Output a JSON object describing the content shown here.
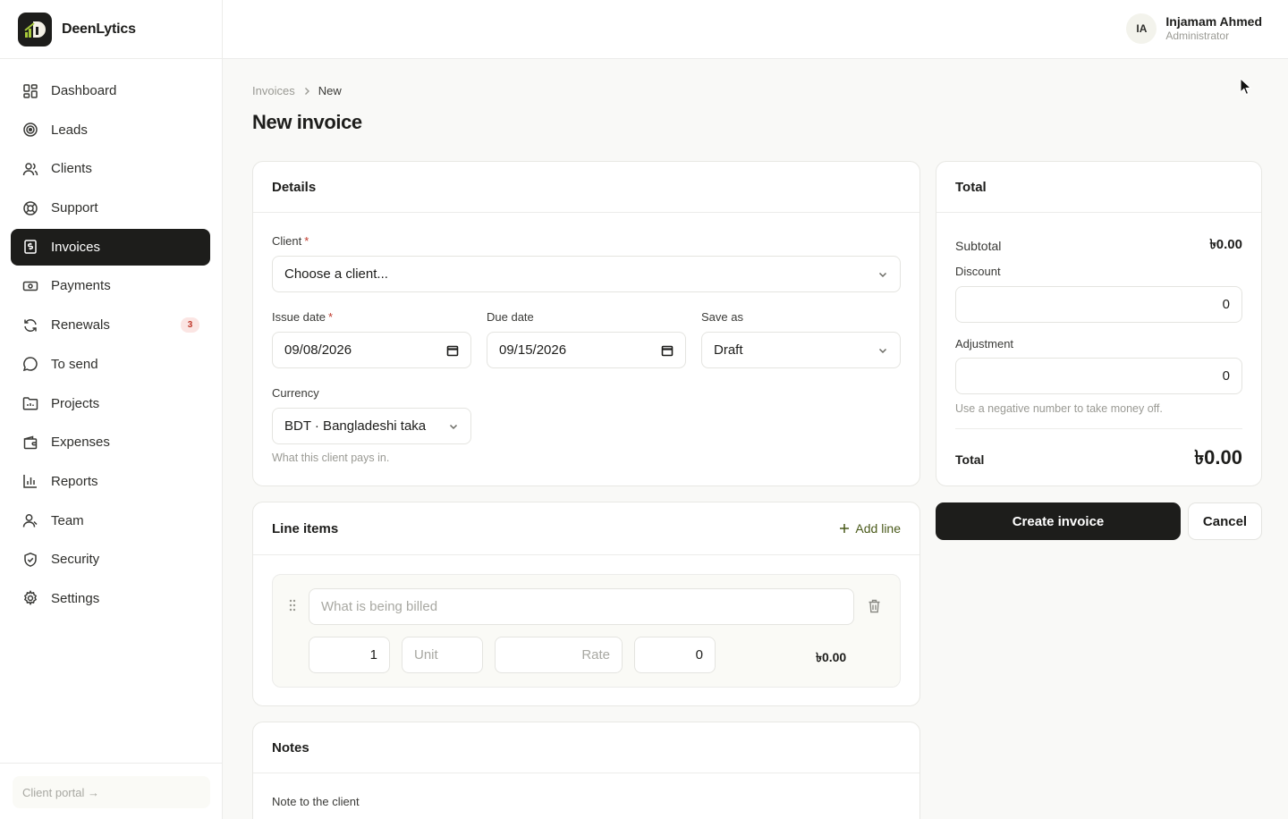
{
  "app": {
    "name": "DeenLytics"
  },
  "user": {
    "initials": "IA",
    "name": "Injamam Ahmed",
    "role": "Administrator"
  },
  "sidebar": {
    "items": [
      {
        "label": "Dashboard",
        "icon": "dashboard-icon"
      },
      {
        "label": "Leads",
        "icon": "target-icon"
      },
      {
        "label": "Clients",
        "icon": "users-icon"
      },
      {
        "label": "Support",
        "icon": "lifebuoy-icon"
      },
      {
        "label": "Invoices",
        "icon": "invoice-icon",
        "active": true
      },
      {
        "label": "Payments",
        "icon": "banknote-icon"
      },
      {
        "label": "Renewals",
        "icon": "refresh-icon",
        "badge": "3"
      },
      {
        "label": "To send",
        "icon": "chat-bubble-icon"
      },
      {
        "label": "Projects",
        "icon": "folder-icon"
      },
      {
        "label": "Expenses",
        "icon": "wallet-icon"
      },
      {
        "label": "Reports",
        "icon": "bar-chart-icon"
      },
      {
        "label": "Team",
        "icon": "team-icon"
      },
      {
        "label": "Security",
        "icon": "shield-icon"
      },
      {
        "label": "Settings",
        "icon": "gear-icon"
      }
    ],
    "footer_link": "Client portal →"
  },
  "breadcrumb": {
    "parent": "Invoices",
    "current": "New"
  },
  "page": {
    "title": "New invoice"
  },
  "details": {
    "title": "Details",
    "client_label": "Client",
    "required_mark": "*",
    "client_value": "Choose a client...",
    "issue_date_label": "Issue date",
    "issue_date_value": "09/08/2026",
    "due_date_label": "Due date",
    "due_date_value": "09/15/2026",
    "save_as_label": "Save as",
    "save_as_value": "Draft",
    "currency_label": "Currency",
    "currency_value": "BDT · Bangladeshi taka",
    "currency_hint": "What this client pays in."
  },
  "line_items": {
    "title": "Line items",
    "add_label": "Add line",
    "description_placeholder": "What is being billed",
    "quantity": "1",
    "unit_placeholder": "Unit",
    "rate_placeholder": "Rate",
    "tax": "0",
    "line_total": "৳0.00"
  },
  "notes": {
    "title": "Notes",
    "note_label": "Note to the client"
  },
  "totals": {
    "title": "Total",
    "subtotal_label": "Subtotal",
    "subtotal_value": "৳0.00",
    "discount_label": "Discount",
    "discount_value": "0",
    "adjustment_label": "Adjustment",
    "adjustment_value": "0",
    "adjustment_hint": "Use a negative number to take money off.",
    "total_label": "Total",
    "total_value": "৳0.00"
  },
  "actions": {
    "create_label": "Create invoice",
    "cancel_label": "Cancel"
  }
}
